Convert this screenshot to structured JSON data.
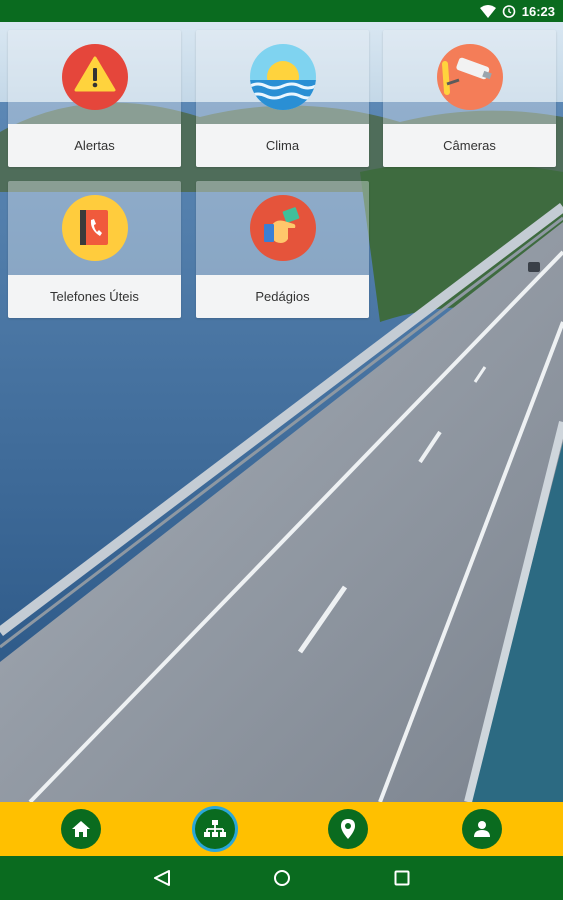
{
  "status_bar": {
    "time": "16:23",
    "icons": [
      "wifi-icon",
      "alarm-icon",
      "battery-icon"
    ]
  },
  "tiles": [
    {
      "label": "Alertas",
      "icon": "warning-icon"
    },
    {
      "label": "Clima",
      "icon": "weather-icon"
    },
    {
      "label": "Câmeras",
      "icon": "camera-icon"
    },
    {
      "label": "Telefones Úteis",
      "icon": "phonebook-icon"
    },
    {
      "label": "Pedágios",
      "icon": "toll-payment-icon"
    }
  ],
  "bottom_nav": {
    "items": [
      {
        "name": "home",
        "icon": "home-icon",
        "active": false
      },
      {
        "name": "sitemap",
        "icon": "sitemap-icon",
        "active": true
      },
      {
        "name": "location",
        "icon": "location-pin-icon",
        "active": false
      },
      {
        "name": "profile",
        "icon": "user-icon",
        "active": false
      }
    ]
  },
  "system_nav": {
    "icons": [
      "back-icon",
      "home-icon",
      "recents-icon"
    ]
  },
  "colors": {
    "primary_green": "#0a6b1f",
    "accent_yellow": "#ffc000",
    "active_ring": "#2aa7d8"
  }
}
